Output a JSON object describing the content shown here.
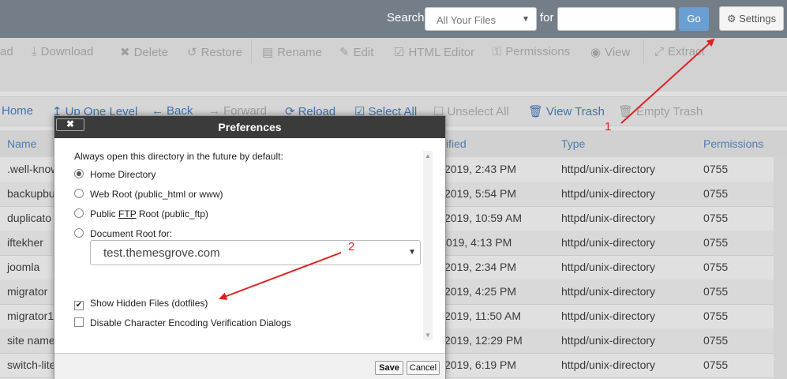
{
  "topbar": {
    "search_label": "Search",
    "search_scope": "All Your Files",
    "for_label": "for",
    "go_label": "Go",
    "settings_label": "Settings"
  },
  "toolbar": {
    "upload_fragment": "ad",
    "download": "Download",
    "delete": "Delete",
    "restore": "Restore",
    "rename": "Rename",
    "edit": "Edit",
    "html_editor": "HTML Editor",
    "permissions": "Permissions",
    "view": "View",
    "extract": "Extract"
  },
  "nav": {
    "home": "Home",
    "up_one_level": "Up One Level",
    "back": "Back",
    "forward": "Forward",
    "reload": "Reload",
    "select_all": "Select All",
    "unselect_all": "Unselect All",
    "view_trash": "View Trash",
    "empty_trash": "Empty Trash"
  },
  "table": {
    "headers": {
      "name": "Name",
      "modified": "ified",
      "type": "Type",
      "permissions": "Permissions"
    },
    "rows": [
      {
        "name": ".well-know",
        "modified": "2019, 2:43 PM",
        "type": "httpd/unix-directory",
        "perm": "0755"
      },
      {
        "name": "backupbu",
        "modified": "2019, 5:54 PM",
        "type": "httpd/unix-directory",
        "perm": "0755"
      },
      {
        "name": "duplicato",
        "modified": "2019, 10:59 AM",
        "type": "httpd/unix-directory",
        "perm": "0755"
      },
      {
        "name": "iftekher",
        "modified": "019, 4:13 PM",
        "type": "httpd/unix-directory",
        "perm": "0755"
      },
      {
        "name": "joomla",
        "modified": "2019, 2:34 PM",
        "type": "httpd/unix-directory",
        "perm": "0755"
      },
      {
        "name": "migrator",
        "modified": "2019, 4:25 PM",
        "type": "httpd/unix-directory",
        "perm": "0755"
      },
      {
        "name": "migrator1",
        "modified": "2019, 11:50 AM",
        "type": "httpd/unix-directory",
        "perm": "0755"
      },
      {
        "name": "site name",
        "modified": "2019, 12:29 PM",
        "type": "httpd/unix-directory",
        "perm": "0755"
      },
      {
        "name": "switch-lite",
        "modified": "2019, 6:19 PM",
        "type": "httpd/unix-directory",
        "perm": "0755"
      }
    ]
  },
  "dialog": {
    "title": "Preferences",
    "close_label": "✖",
    "heading": "Always open this directory in the future by default:",
    "options": {
      "home": "Home Directory",
      "webroot": "Web Root (public_html or www)",
      "ftp_pre": "Public ",
      "ftp_abbr": "FTP",
      "ftp_post": " Root (public_ftp)",
      "docroot": "Document Root for:"
    },
    "domain": "test.themesgrove.com",
    "show_hidden": "Show Hidden Files (dotfiles)",
    "disable_encoding": "Disable Character Encoding Verification Dialogs",
    "save": "Save",
    "cancel": "Cancel"
  },
  "annotations": {
    "one": "1",
    "two": "2"
  },
  "colors": {
    "accent": "#4c84c4",
    "annotation": "#e02020",
    "title_bar": "#3b3b3b",
    "topbar": "#737e88"
  }
}
